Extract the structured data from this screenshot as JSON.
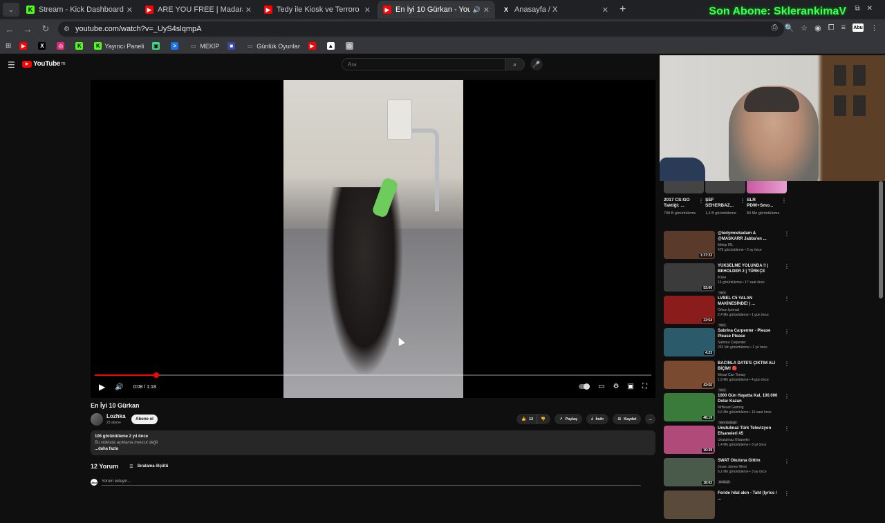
{
  "browser": {
    "tabs": [
      {
        "title": "Stream - Kick Dashboard",
        "favicon_color": "#53fc18",
        "favicon_glyph": "K",
        "active": false
      },
      {
        "title": "ARE YOU FREE | Madara Olduk",
        "favicon_color": "#ff0000",
        "favicon_glyph": "▶",
        "active": false
      },
      {
        "title": "Tedy ile Kiosk ve Terroro - YouT",
        "favicon_color": "#ff0000",
        "favicon_glyph": "▶",
        "active": false
      },
      {
        "title": "En İyi 10 Gürkan - YouTube",
        "favicon_color": "#ff0000",
        "favicon_glyph": "▶",
        "active": true
      },
      {
        "title": "Anasayfa / X",
        "favicon_color": "#202124",
        "favicon_glyph": "X",
        "active": false
      }
    ],
    "overlay_text": "Son Abone: SklerankimaV",
    "url": "youtube.com/watch?v=_UyS4slqmpA",
    "profile_label": "Abu",
    "bookmarks": [
      {
        "label": "",
        "color": "#ff0000",
        "glyph": "▶"
      },
      {
        "label": "",
        "color": "#000000",
        "glyph": "X"
      },
      {
        "label": "",
        "color": "#d62976",
        "glyph": "◎"
      },
      {
        "label": "",
        "color": "#53fc18",
        "glyph": "K"
      },
      {
        "label": "Yayıncı Paneli",
        "color": "#53fc18",
        "glyph": "K"
      },
      {
        "label": "",
        "color": "#3ddc84",
        "glyph": "▣"
      },
      {
        "label": "",
        "color": "#1a73e8",
        "glyph": ">"
      },
      {
        "label": "MEKİP",
        "color": "#9aa0a6",
        "glyph": "▭"
      },
      {
        "label": "",
        "color": "#3949ab",
        "glyph": "■"
      },
      {
        "label": "Günlük Oyunlar",
        "color": "#9aa0a6",
        "glyph": "▭"
      },
      {
        "label": "",
        "color": "#ff0000",
        "glyph": "▶"
      },
      {
        "label": "",
        "color": "#ffffff",
        "glyph": "▲"
      },
      {
        "label": "",
        "color": "#9aa0a6",
        "glyph": "◎"
      }
    ]
  },
  "youtube": {
    "logo_text": "YouTube",
    "logo_country": "TR",
    "search_placeholder": "Ara",
    "player": {
      "current_time": "0:08",
      "duration": "1:18",
      "timecode": "0:08 / 1:18",
      "progress_fraction": 0.11
    },
    "video": {
      "title": "En İyi 10 Gürkan",
      "channel": "Lozhka",
      "subscribers": "23 abone",
      "subscribe_label": "Abone ol",
      "likes": "12",
      "share_label": "Paylaş",
      "download_label": "İndir",
      "save_label": "Kaydet",
      "more_label": "...",
      "stats": "106 görüntüleme  2 yıl önce",
      "description": "Bu videoda açıklama mevcut değil.",
      "show_more": "...daha fazla"
    },
    "comments": {
      "count_label": "12 Yorum",
      "sort_label": "Sıralama ölçütü",
      "add_placeholder": "Yorum ekleyin...",
      "avatar_label": "Abu"
    },
    "shorts": [
      {
        "title": "2017 CS:GO Taktiği: ...",
        "views": "798 B görüntüleme"
      },
      {
        "title": "ŞEF SEHERBAZ...",
        "views": "1,4 B görüntüleme"
      },
      {
        "title": "SLR PDW+Smo...",
        "views": "84 Mn görüntüleme"
      }
    ],
    "recommendations": [
      {
        "title": "@tedymcekadam & @MASKARR Jabba'en ...",
        "channel": "Mekip IRL",
        "meta": "479 görüntüleme • 2 ay önce",
        "duration": "1:37:23",
        "badge": "",
        "thumb_color": "#5a3a2a"
      },
      {
        "title": "YÜKSELME YOLUNDA !! | BEHOLDER 2 | TÜRKÇE BÖLÜ...",
        "channel": "iKtsie",
        "meta": "16 görüntüleme • 17 saat önce",
        "duration": "53:06",
        "badge": "Yeni",
        "thumb_color": "#3b3b3b"
      },
      {
        "title": "LVBEL C5 YALAN MAKİNESİNDE! | ...",
        "channel": "Orkun Işıtmak",
        "meta": "2,4 Mn görüntüleme • 1 gün önce",
        "duration": "22:54",
        "badge": "Yeni",
        "thumb_color": "#8a1c1c"
      },
      {
        "title": "Sabrina Carpenter - Please Please Please",
        "channel": "Sabrina Carpenter",
        "meta": "253 Mn görüntüleme • 1 yıl önce",
        "duration": "4:23",
        "badge": "",
        "thumb_color": "#2b5a6a"
      },
      {
        "title": "BACINLA DATE'E ÇIKTIM ALİ BİÇİM! 🔴",
        "channel": "Mesut Can Tomay",
        "meta": "1,9 Mn görüntüleme • 4 gün önce",
        "duration": "42:56",
        "badge": "Yeni",
        "thumb_color": "#7a4a30"
      },
      {
        "title": "1000 Gün Hayatta Kal, 100.000 Dolar Kazan",
        "channel": "MrBeast Gaming",
        "meta": "6,6 Mn görüntüleme • 16 saat önce",
        "duration": "48:19",
        "badge": "Yeni  Dublajlı",
        "thumb_color": "#3a7a3a"
      },
      {
        "title": "Unutulmaz Türk Televizyon Efsaneleri #5",
        "channel": "Unutulmaz Efsaneler",
        "meta": "1,4 Mn görüntüleme • 3 yıl önce",
        "duration": "10:39",
        "badge": "",
        "thumb_color": "#b04a78"
      },
      {
        "title": "SWAT Okuluna Gittim",
        "channel": "Jesse James West",
        "meta": "6,2 Mn görüntüleme • 3 ay önce",
        "duration": "18:02",
        "badge": "Dublajlı",
        "thumb_color": "#4a5a4a"
      },
      {
        "title": "Feride hilal akın - Taht (lyrics / ...",
        "channel": "",
        "meta": "",
        "duration": "",
        "badge": "",
        "thumb_color": "#5a4a3a"
      }
    ]
  }
}
